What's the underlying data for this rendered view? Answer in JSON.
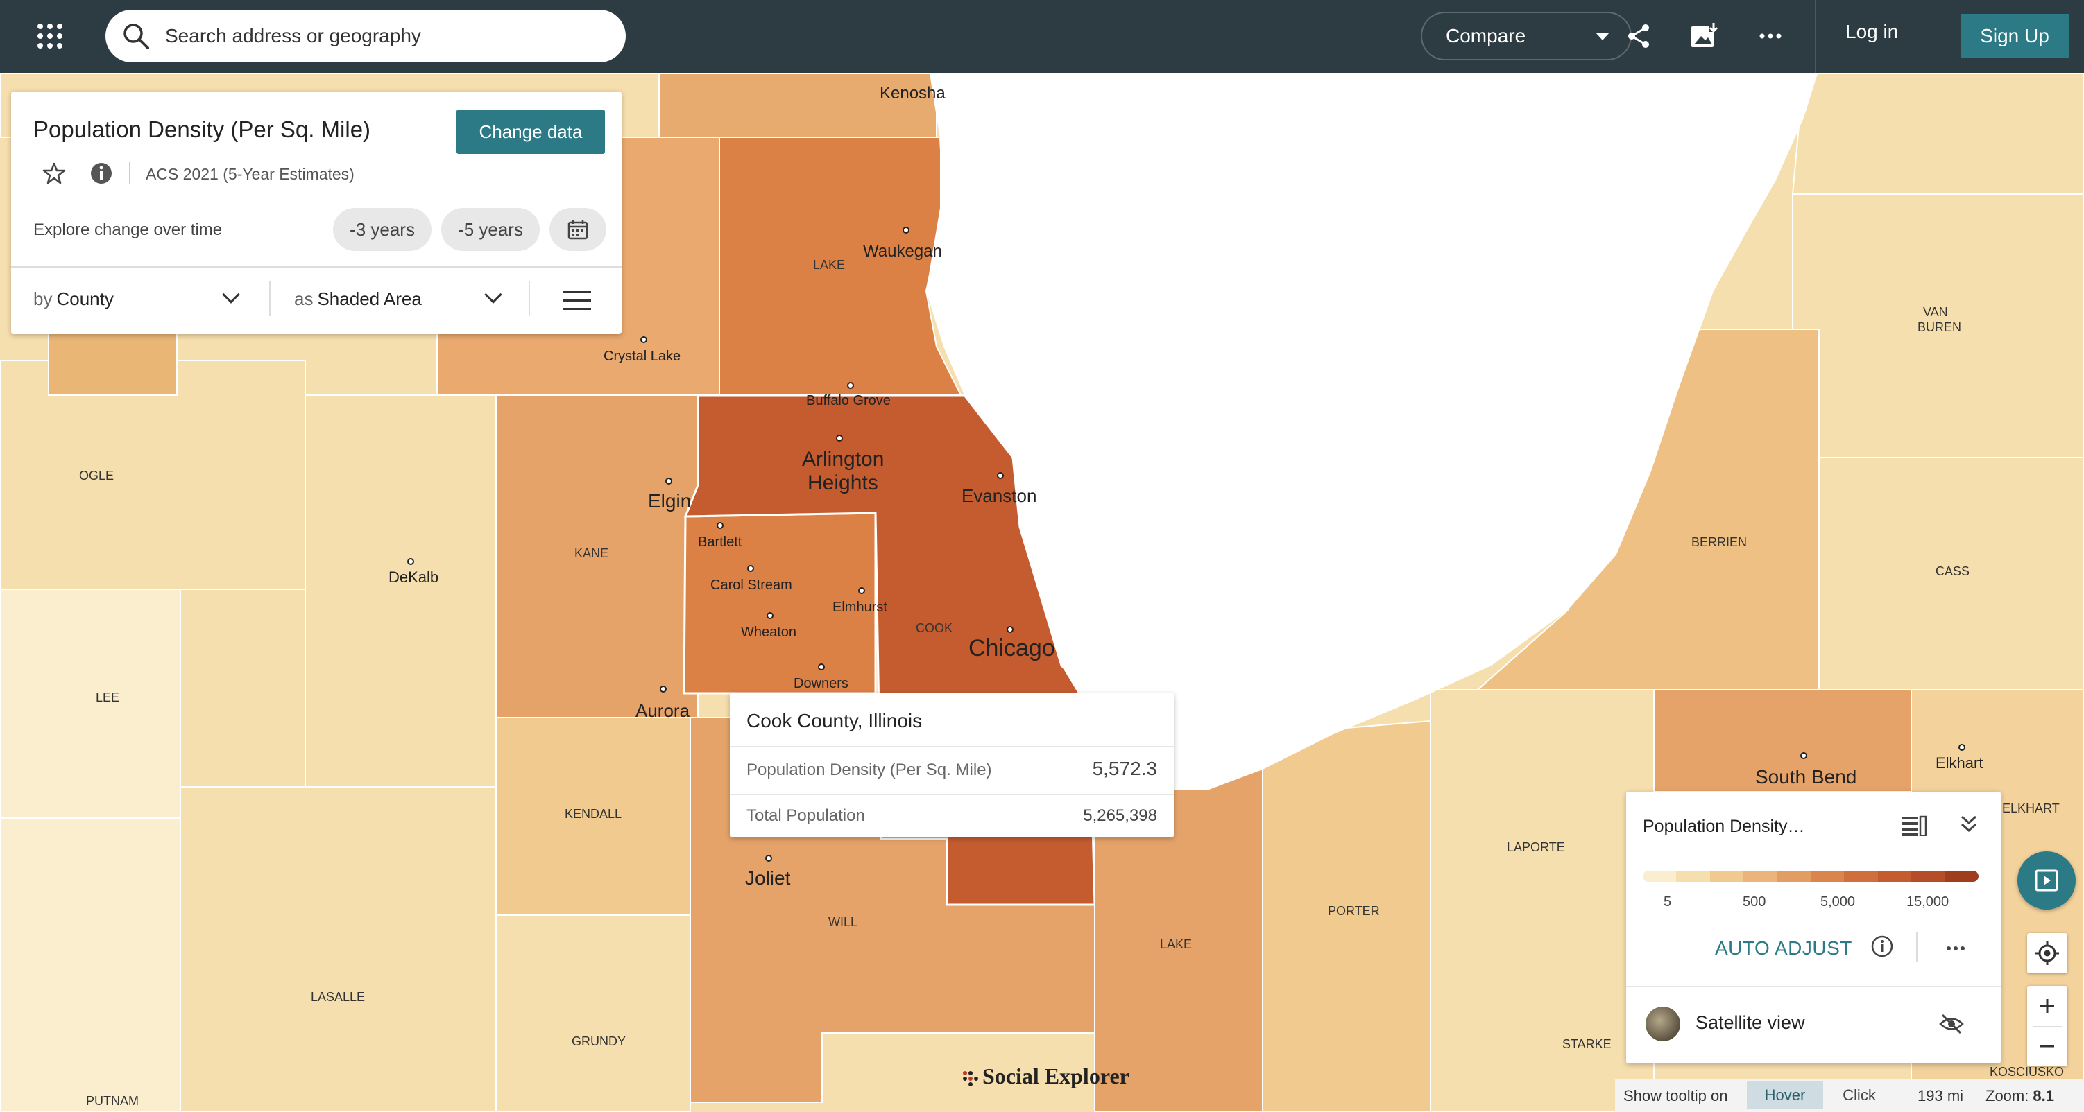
{
  "topbar": {
    "search_placeholder": "Search address or geography",
    "compare_label": "Compare",
    "login_label": "Log in",
    "signup_label": "Sign Up",
    "icons": [
      "apps-grid-icon",
      "search-icon",
      "share-icon",
      "export-image-icon",
      "more-icon"
    ]
  },
  "panel": {
    "title": "Population Density (Per Sq. Mile)",
    "change_data_label": "Change data",
    "survey": "ACS 2021 (5-Year Estimates)",
    "explore_label": "Explore change over time",
    "pill_3": "-3 years",
    "pill_5": "-5 years",
    "by_prefix": "by",
    "by_value": "County",
    "as_prefix": "as",
    "as_value": "Shaded Area"
  },
  "tooltip": {
    "title": "Cook County, Illinois",
    "rows": [
      {
        "label": "Population Density (Per Sq. Mile)",
        "value": "5,572.3"
      },
      {
        "label": "Total Population",
        "value": "5,265,398"
      }
    ]
  },
  "legend": {
    "title": "Population Density…",
    "ticks": [
      "5",
      "500",
      "5,000",
      "15,000"
    ],
    "colors": [
      "#fbeecf",
      "#f6dfae",
      "#f0ca8e",
      "#ebb47a",
      "#e29d62",
      "#d9854c",
      "#cf6f3e",
      "#c45c30",
      "#b54d28",
      "#9e3e1e"
    ],
    "auto_adjust_label": "AUTO ADJUST",
    "satellite_label": "Satellite view"
  },
  "bottombar": {
    "tooltip_label": "Show tooltip on",
    "hover_label": "Hover",
    "click_label": "Click",
    "scale": "193 mi",
    "zoom_label": "Zoom:",
    "zoom_value": "8.1"
  },
  "brand": "Social Explorer",
  "colors": {
    "topbar": "#2d3b42",
    "accent": "#2c7a86",
    "lake": "#ffffff"
  },
  "map": {
    "county_labels": [
      "OGLE",
      "LEE",
      "LASALLE",
      "PUTNAM",
      "GRUNDY",
      "KENDALL",
      "KANE",
      "LAKE",
      "COOK",
      "WILL",
      "LAKE",
      "PORTER",
      "LAPORTE",
      "STARKE",
      "BERRIEN",
      "CASS",
      "VAN",
      "BUREN",
      "ELKHART",
      "KOSCIUSKO"
    ],
    "cities": [
      "Kenosha",
      "Waukegan",
      "Crystal Lake",
      "Buffalo Grove",
      "Arlington",
      "Heights",
      "Elgin",
      "Evanston",
      "Bartlett",
      "Carol Stream",
      "Wheaton",
      "Elmhurst",
      "Downers",
      "Chicago",
      "Aurora",
      "DeKalb",
      "Joliet",
      "South Bend",
      "Elkhart"
    ]
  }
}
